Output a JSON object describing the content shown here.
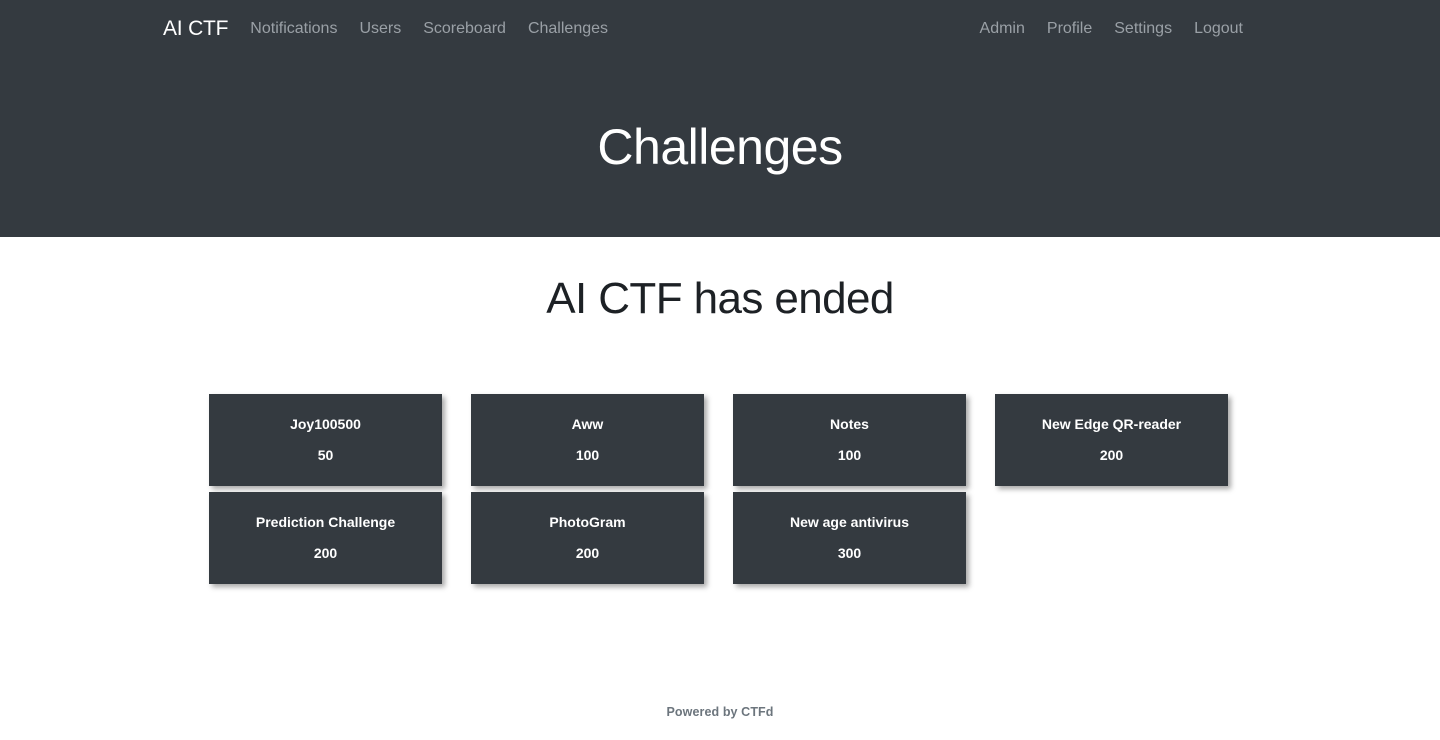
{
  "navbar": {
    "brand": "AI CTF",
    "left_links": [
      {
        "label": "Notifications",
        "name": "notifications"
      },
      {
        "label": "Users",
        "name": "users"
      },
      {
        "label": "Scoreboard",
        "name": "scoreboard"
      },
      {
        "label": "Challenges",
        "name": "challenges"
      }
    ],
    "right_links": [
      {
        "label": "Admin",
        "name": "admin"
      },
      {
        "label": "Profile",
        "name": "profile"
      },
      {
        "label": "Settings",
        "name": "settings"
      },
      {
        "label": "Logout",
        "name": "logout"
      }
    ]
  },
  "hero": {
    "title": "Challenges"
  },
  "main": {
    "ended_title": "AI CTF has ended"
  },
  "categories": [
    {
      "challenges": [
        {
          "name": "Joy100500",
          "value": "50"
        },
        {
          "name": "Prediction Challenge",
          "value": "200"
        }
      ]
    },
    {
      "challenges": [
        {
          "name": "Aww",
          "value": "100"
        },
        {
          "name": "PhotoGram",
          "value": "200"
        }
      ]
    },
    {
      "challenges": [
        {
          "name": "Notes",
          "value": "100"
        },
        {
          "name": "New age antivirus",
          "value": "300"
        }
      ]
    },
    {
      "challenges": [
        {
          "name": "New Edge QR-reader",
          "value": "200"
        }
      ]
    }
  ],
  "footer": {
    "text": "Powered by CTFd"
  },
  "colors": {
    "dark": "#343a40",
    "nav_link": "#9aa0a6",
    "page_bg": "#ffffff",
    "footer_text": "#6c757d"
  }
}
